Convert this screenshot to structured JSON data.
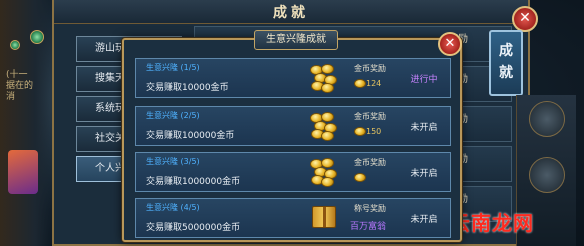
{
  "back_window": {
    "title": "成就",
    "close_icon": "close-icon",
    "sidebar_items": [
      "游山玩",
      "搜集天",
      "系统玩",
      "社交关",
      "个人兴趣"
    ],
    "row_reward_label": "奖励"
  },
  "right_tab": {
    "chars": [
      "成",
      "就"
    ]
  },
  "side_note": "(十一据在的消",
  "dialog": {
    "title": "生意兴隆成就",
    "close_icon": "close-icon",
    "achievements": [
      {
        "title": "生意兴隆 (1/5)",
        "desc": "交易赚取10000金币",
        "reward_label": "金币奖励",
        "reward_value": "124",
        "reward_kind": "coin",
        "status": "进行中",
        "icon": "gold-coins-icon"
      },
      {
        "title": "生意兴隆 (2/5)",
        "desc": "交易赚取100000金币",
        "reward_label": "金币奖励",
        "reward_value": "150",
        "reward_kind": "coin",
        "status": "未开启",
        "icon": "gold-coins-icon"
      },
      {
        "title": "生意兴隆 (3/5)",
        "desc": "交易赚取1000000金币",
        "reward_label": "金币奖励",
        "reward_value": "",
        "reward_kind": "coin",
        "status": "未开启",
        "icon": "gold-coins-icon"
      },
      {
        "title": "生意兴隆 (4/5)",
        "desc": "交易赚取5000000金币",
        "reward_label": "称号奖励",
        "reward_value": "百万富翁",
        "reward_kind": "title",
        "status": "未开启",
        "icon": "book-icon"
      }
    ]
  },
  "watermark_brand": "云南龙网",
  "colors": {
    "accent_gold": "#b9985a",
    "row_blue": "#274562",
    "title_blue": "#4fb2ff",
    "status_active": "#c884ff",
    "brand_red": "#ff2a1f"
  }
}
